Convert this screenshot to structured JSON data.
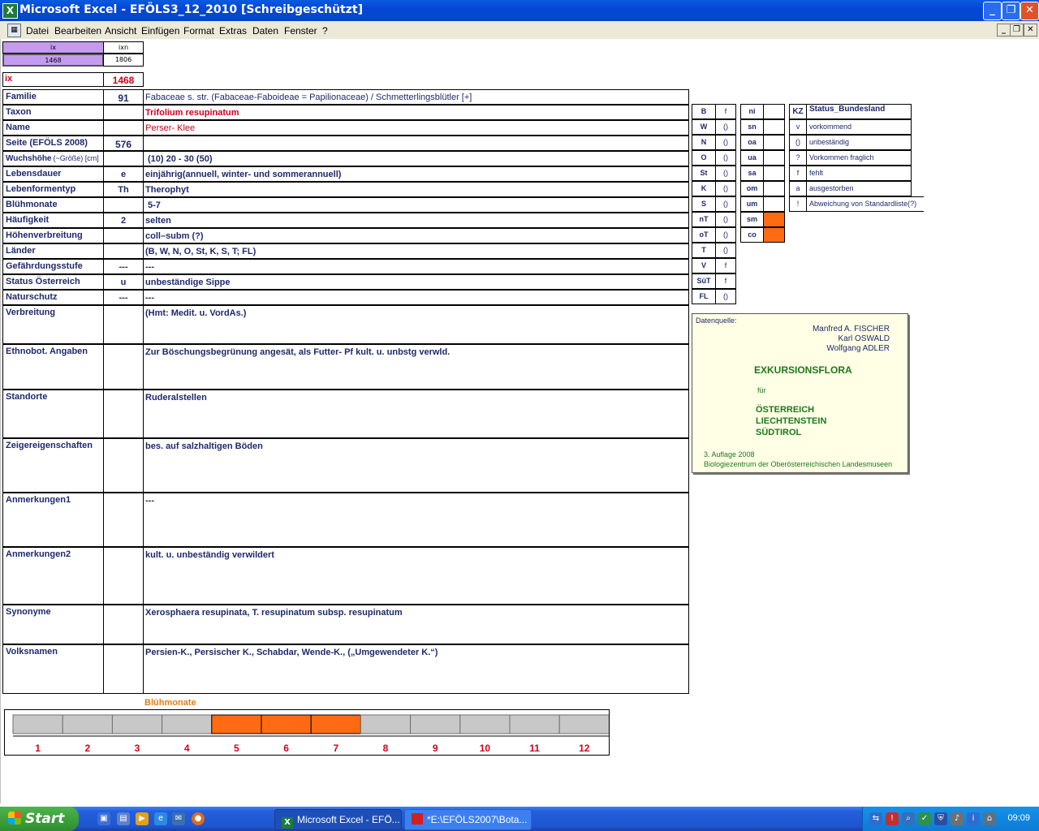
{
  "window": {
    "title": "Microsoft Excel - EFÖLS3_12_2010  [Schreibgeschützt]"
  },
  "menu": [
    "Datei",
    "Bearbeiten",
    "Ansicht",
    "Einfügen",
    "Format",
    "Extras",
    "Daten",
    "Fenster",
    "?"
  ],
  "topcells": {
    "ix_label": "ix",
    "ixn_label": "ixn",
    "ix_value": "1468",
    "ixn_value": "1806",
    "ix_big_label": "ix",
    "ix_big_value": "1468"
  },
  "rows": [
    {
      "label": "Familie",
      "code": "91",
      "value": "Fabaceae s. str. (Fabaceae-Faboideae = Papilionaceae)  /  Schmetterlingsblütler [+]"
    },
    {
      "label": "Taxon",
      "code": "",
      "value": "Trifolium resupinatum"
    },
    {
      "label": "Name",
      "code": "",
      "value": "Perser- Klee"
    },
    {
      "label": "Seite (EFÖLS 2008)",
      "code": "576",
      "value": ""
    },
    {
      "label": "Wuchshöhe",
      "label_suffix": "(~Größe) [cm]",
      "code": "",
      "value": "(10) 20 - 30 (50)"
    },
    {
      "label": "Lebensdauer",
      "code": "e",
      "value": "einjährig(annuell, winter- und sommerannuell)"
    },
    {
      "label": "Lebenformentyp",
      "code": "Th",
      "value": "Therophyt"
    },
    {
      "label": "Blühmonate",
      "code": "",
      "value": "5-7"
    },
    {
      "label": "Häufigkeit",
      "code": "2",
      "value": "selten"
    },
    {
      "label": "Höhenverbreitung",
      "code": "",
      "value": "coll–subm (?)"
    },
    {
      "label": "Länder",
      "code": "",
      "value": "(B, W, N, O, St, K, S, T; FL)"
    },
    {
      "label": "Gefährdungsstufe",
      "code": "---",
      "value": "---"
    },
    {
      "label": "Status Österreich",
      "code": "u",
      "value": "unbeständige Sippe"
    },
    {
      "label": "Naturschutz",
      "code": "---",
      "value": "---"
    },
    {
      "label": "Verbreitung",
      "code": "",
      "value": "(Hmt: Medit. u. VordAs.)"
    },
    {
      "label": "Ethnobot. Angaben",
      "code": "",
      "value": "Zur Böschungsbegrünung angesät, als Futter- Pf kult. u. unbstg verwld."
    },
    {
      "label": "Standorte",
      "code": "",
      "value": "Ruderalstellen"
    },
    {
      "label": "Zeigereigenschaften",
      "code": "",
      "value": "bes. auf salzhaltigen Böden"
    },
    {
      "label": "Anmerkungen1",
      "code": "",
      "value": "---"
    },
    {
      "label": "Anmerkungen2",
      "code": "",
      "value": "kult. u. unbeständig verwildert"
    },
    {
      "label": "Synonyme",
      "code": "",
      "value": "Xerosphaera resupinata, T. resupinatum subsp. resupinatum"
    },
    {
      "label": "Volksnamen",
      "code": "",
      "value": "Persien-K., Persischer K., Schabdar,   Wende-K., („Umgewendeter K.“)"
    }
  ],
  "bundesland_status": [
    {
      "code": "B",
      "status": "f"
    },
    {
      "code": "W",
      "status": "()"
    },
    {
      "code": "N",
      "status": "()"
    },
    {
      "code": "O",
      "status": "()"
    },
    {
      "code": "St",
      "status": "()"
    },
    {
      "code": "K",
      "status": "()"
    },
    {
      "code": "S",
      "status": "()"
    },
    {
      "code": "nT",
      "status": "()"
    },
    {
      "code": "oT",
      "status": "()"
    },
    {
      "code": "T",
      "status": "()"
    },
    {
      "code": "V",
      "status": "f"
    },
    {
      "code": "SüT",
      "status": "f"
    },
    {
      "code": "FL",
      "status": "()"
    }
  ],
  "height_zones": [
    {
      "code": "ni",
      "filled": false
    },
    {
      "code": "sn",
      "filled": false
    },
    {
      "code": "oa",
      "filled": false
    },
    {
      "code": "ua",
      "filled": false
    },
    {
      "code": "sa",
      "filled": false
    },
    {
      "code": "om",
      "filled": false
    },
    {
      "code": "um",
      "filled": false
    },
    {
      "code": "sm",
      "filled": true
    },
    {
      "code": "co",
      "filled": true
    }
  ],
  "legend": {
    "header_kz": "KZ",
    "header_status": "Status_Bundesland",
    "items": [
      {
        "kz": "v",
        "text": "vorkommend"
      },
      {
        "kz": "()",
        "text": "unbeständig"
      },
      {
        "kz": "?",
        "text": "Vorkommen fraglich"
      },
      {
        "kz": "f",
        "text": "fehlt"
      },
      {
        "kz": "a",
        "text": "ausgestorben"
      },
      {
        "kz": "!",
        "text": "Abweichung von Standardliste(?)"
      }
    ]
  },
  "source": {
    "label": "Datenquelle:",
    "authors": [
      "Manfred A. FISCHER",
      "Karl OSWALD",
      "Wolfgang ADLER"
    ],
    "book_title": "EXKURSIONSFLORA",
    "fuer": "für",
    "regions": [
      "ÖSTERREICH",
      "LIECHTENSTEIN",
      "SÜDTIROL"
    ],
    "edition": "3. Auflage 2008",
    "publisher": "Biologiezentrum der Oberösterreichischen Landesmuseen"
  },
  "chart_data": {
    "type": "bar",
    "title": "Blühmonate",
    "categories": [
      "1",
      "2",
      "3",
      "4",
      "5",
      "6",
      "7",
      "8",
      "9",
      "10",
      "11",
      "12"
    ],
    "values": [
      0,
      0,
      0,
      0,
      1,
      1,
      1,
      0,
      0,
      0,
      0,
      0
    ],
    "colors": {
      "on": "#ff6a13",
      "off": "#c8c8c8"
    }
  },
  "taskbar": {
    "start": "Start",
    "tasks": [
      "Microsoft Excel - EFÖ...",
      "*E:\\EFÖLS2007\\Bota..."
    ],
    "clock": "09:09"
  },
  "colors": {
    "accent_orange": "#ff6a13",
    "ix_purple": "#c59bf0",
    "red_value": "#d0021b"
  }
}
